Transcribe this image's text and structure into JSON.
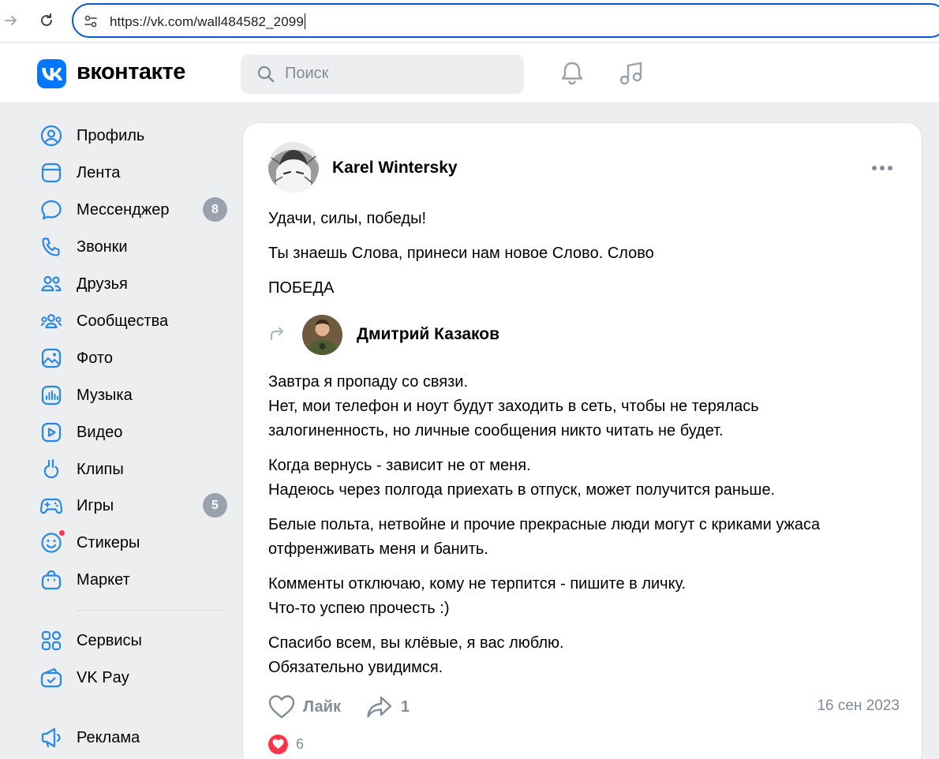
{
  "browser": {
    "url": "https://vk.com/wall484582_2099"
  },
  "header": {
    "brand": "вконтакте",
    "search_placeholder": "Поиск"
  },
  "sidebar": {
    "items": [
      {
        "label": "Профиль",
        "icon": "profile-icon"
      },
      {
        "label": "Лента",
        "icon": "feed-icon"
      },
      {
        "label": "Мессенджер",
        "icon": "messenger-icon",
        "badge": "8"
      },
      {
        "label": "Звонки",
        "icon": "phone-icon"
      },
      {
        "label": "Друзья",
        "icon": "friends-icon"
      },
      {
        "label": "Сообщества",
        "icon": "communities-icon"
      },
      {
        "label": "Фото",
        "icon": "photo-icon"
      },
      {
        "label": "Музыка",
        "icon": "music-icon"
      },
      {
        "label": "Видео",
        "icon": "video-icon"
      },
      {
        "label": "Клипы",
        "icon": "clips-icon"
      },
      {
        "label": "Игры",
        "icon": "games-icon",
        "badge": "5"
      },
      {
        "label": "Стикеры",
        "icon": "stickers-icon"
      },
      {
        "label": "Маркет",
        "icon": "market-icon"
      },
      {
        "label": "Сервисы",
        "icon": "services-icon"
      },
      {
        "label": "VK Pay",
        "icon": "vkpay-icon"
      },
      {
        "label": "Реклама",
        "icon": "ads-icon"
      }
    ]
  },
  "post": {
    "author": "Karel Wintersky",
    "lines": [
      "Удачи, силы, победы!",
      "Ты знаешь Слова, принеси нам новое Слово. Слово",
      "ПОБЕДА"
    ],
    "repost": {
      "author": "Дмитрий Казаков",
      "lines": [
        "Завтра я пропаду со связи.",
        "Нет, мои телефон и ноут будут заходить в сеть, чтобы не терялась",
        "залогиненность, но личные сообщения никто читать не будет.",
        "Когда вернусь - зависит не от меня.",
        "Надеюсь через полгода приехать в отпуск, может получится раньше.",
        "Белые польта, нетвойне и прочие прекрасные люди могут с криками ужаса",
        "отфренживать меня и банить.",
        "Комменты отключаю, кому не терпится - пишите в личку.",
        "Что-то успею прочесть :)",
        "Спасибо всем, вы клёвые, я вас люблю.",
        "Обязательно увидимся."
      ]
    },
    "like_label": "Лайк",
    "share_count": "1",
    "date": "16 сен 2023",
    "reaction_count": "6"
  },
  "colors": {
    "accent": "#2688eb",
    "brand": "#0077ff",
    "reaction": "#ff3347",
    "muted": "#818c99"
  }
}
